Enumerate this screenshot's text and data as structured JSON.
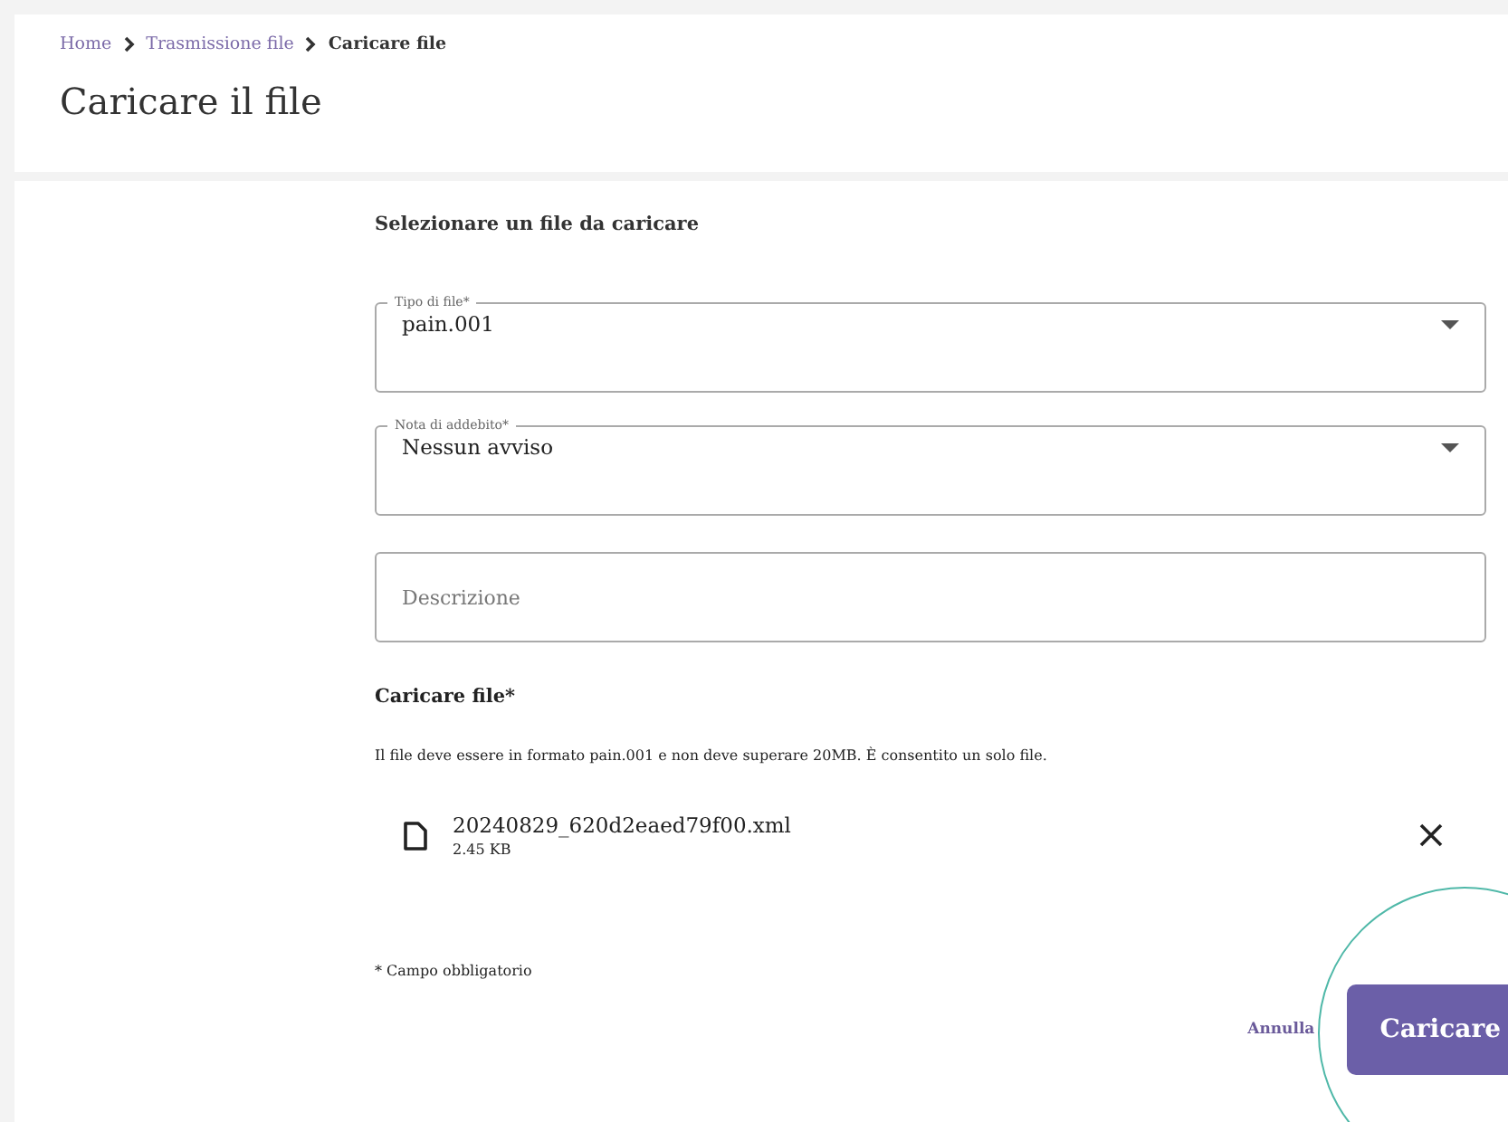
{
  "breadcrumb": [
    {
      "label": "Home",
      "current": false
    },
    {
      "label": "Trasmissione file",
      "current": false
    },
    {
      "label": "Caricare file",
      "current": true
    }
  ],
  "page_title": "Caricare il file",
  "form": {
    "heading": "Selezionare un file da caricare",
    "fields": [
      {
        "kind": "select",
        "label": "Tipo di file*",
        "value": "pain.001"
      },
      {
        "kind": "select",
        "label": "Nota di addebito*",
        "value": "Nessun avviso"
      },
      {
        "kind": "text",
        "placeholder": "Descrizione"
      }
    ],
    "upload": {
      "title": "Caricare file*",
      "hint": "Il file deve essere in formato pain.001 e non deve superare 20MB. È consentito un solo file.",
      "files": [
        {
          "name": "20240829_620d2eaed79f00.xml",
          "size": "2.45 KB"
        }
      ]
    },
    "required_note": "* Campo obbligatorio",
    "cancel": "Annulla",
    "submit": "Caricare"
  }
}
